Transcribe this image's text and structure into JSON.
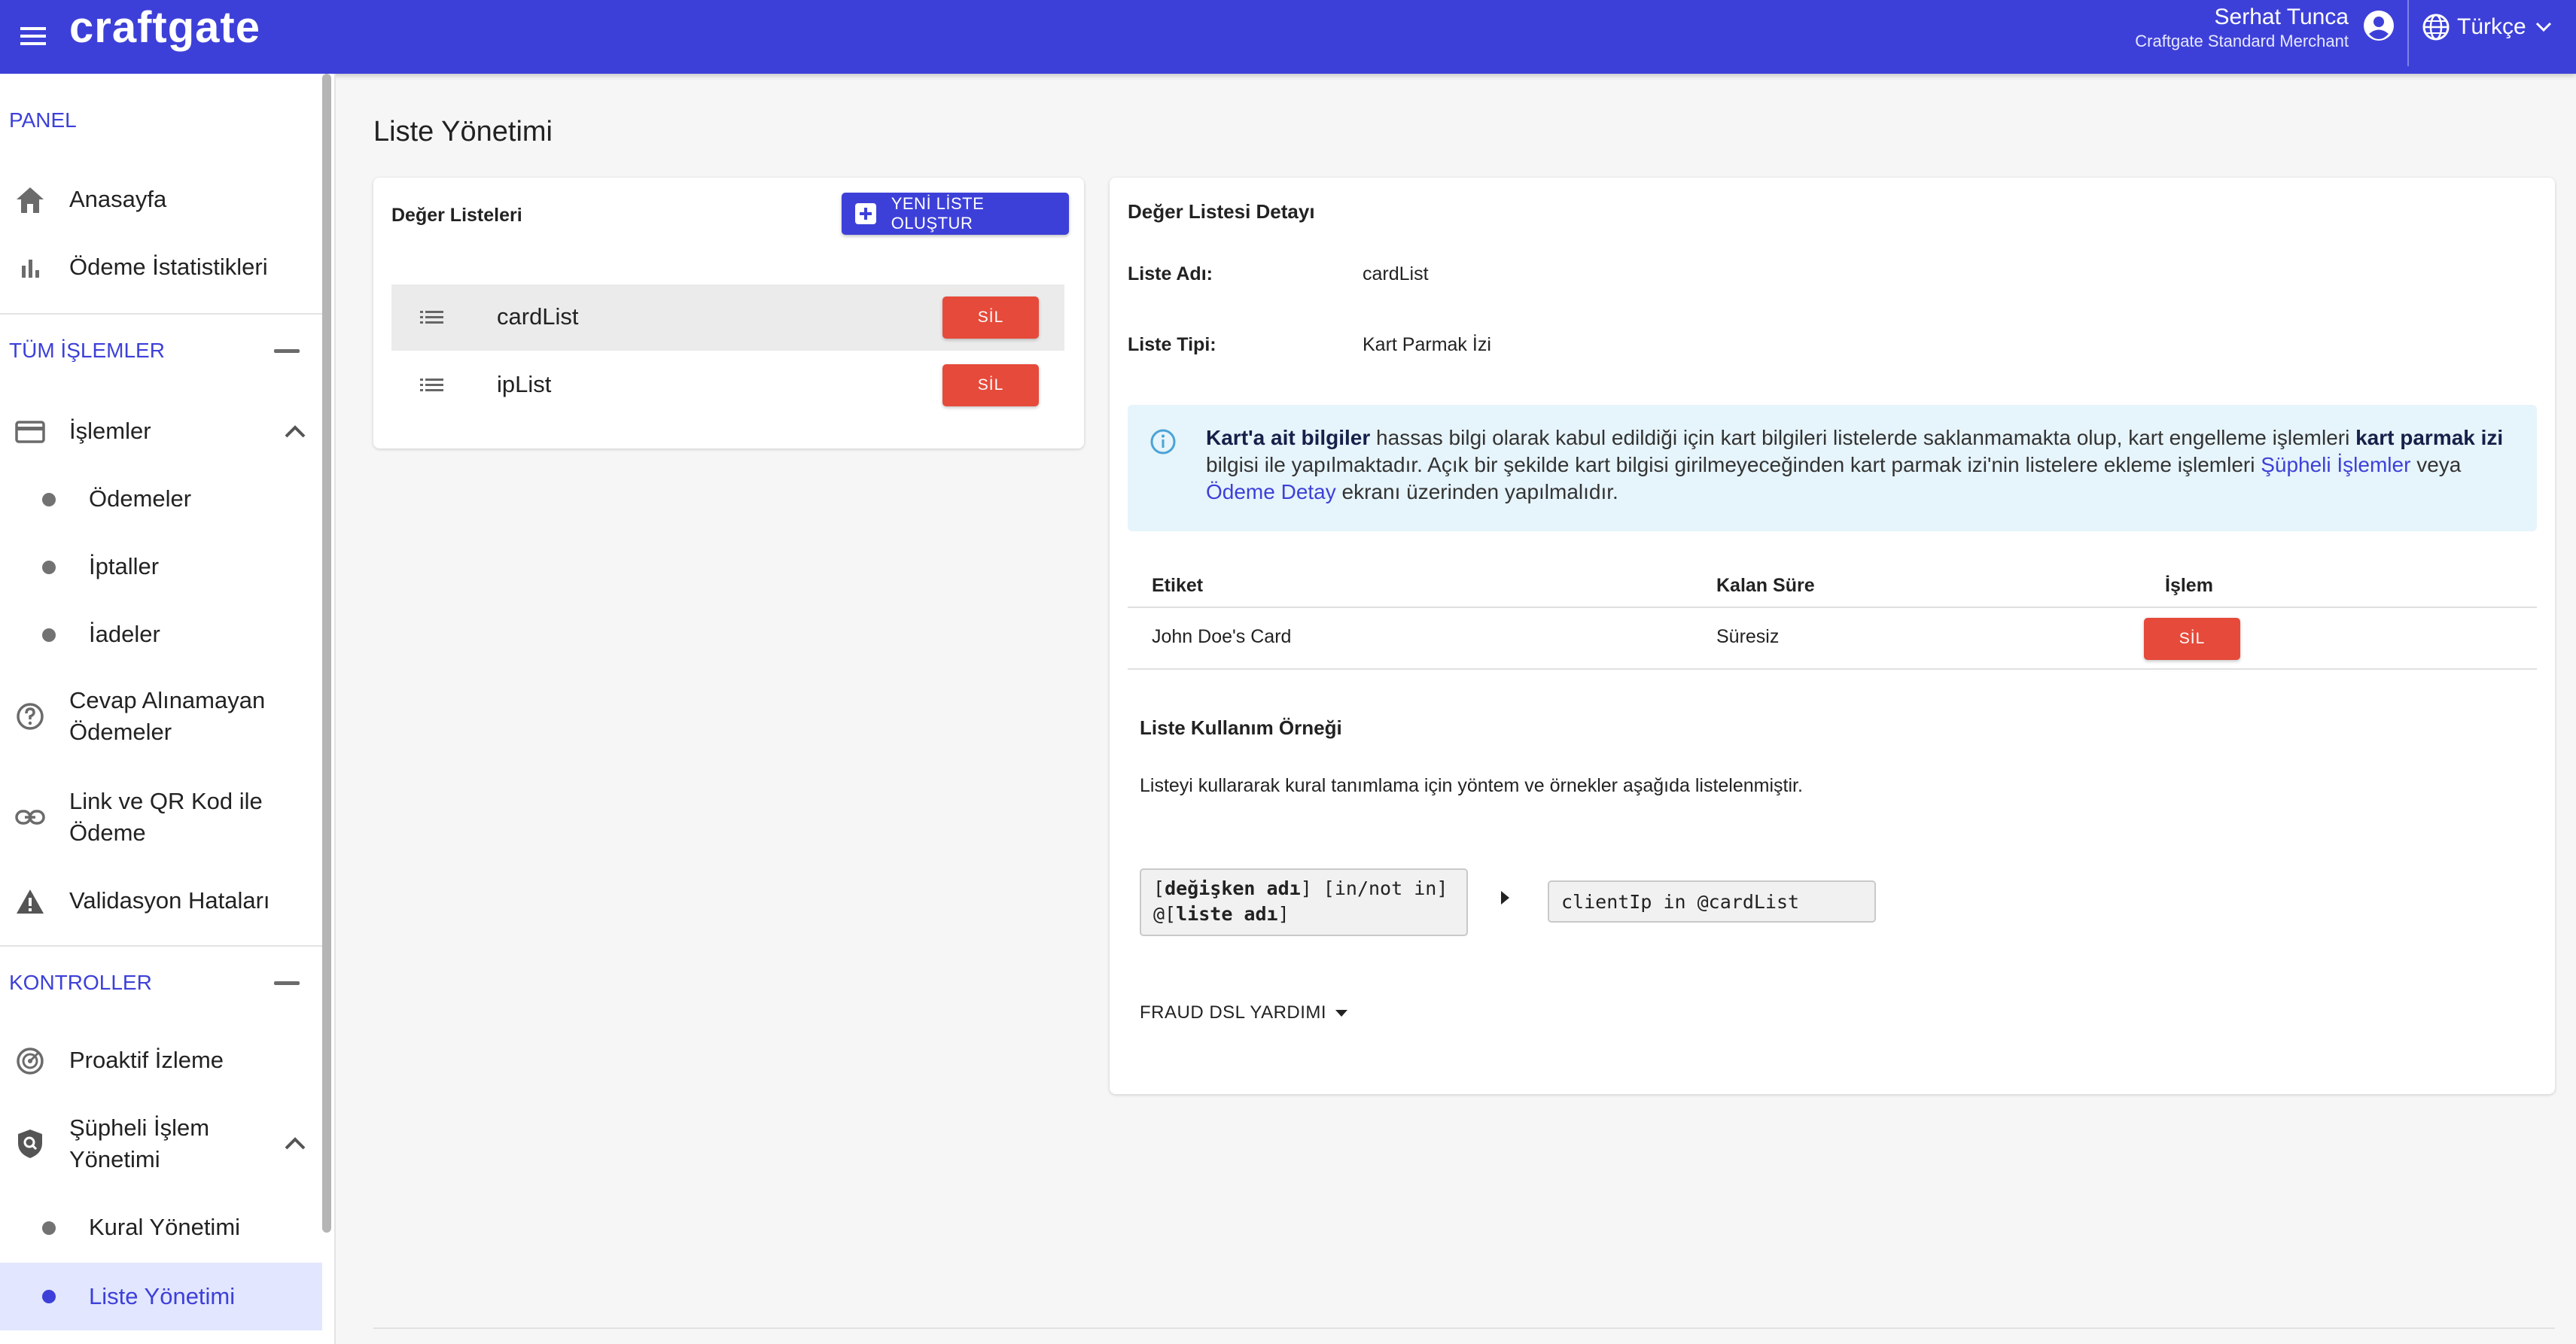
{
  "header": {
    "logo": "craftgate",
    "user_name": "Serhat Tunca",
    "user_role": "Craftgate Standard Merchant",
    "language": "Türkçe",
    "colors": {
      "primary": "#3d40d8"
    },
    "icons": [
      "menu-icon",
      "account-circle-icon",
      "globe-icon",
      "chevron-down-icon"
    ]
  },
  "sidebar": {
    "sections": [
      {
        "title": "PANEL"
      },
      {
        "title": "TÜM İŞLEMLER"
      },
      {
        "title": "KONTROLLER"
      }
    ],
    "items": {
      "anasayfa": "Anasayfa",
      "odeme_istatistikleri": "Ödeme İstatistikleri",
      "islemler": "İşlemler",
      "odemeler": "Ödemeler",
      "iptaller": "İptaller",
      "iadeler": "İadeler",
      "cevap_line1": "Cevap Alınamayan",
      "cevap_line2": "Ödemeler",
      "link_line1": "Link ve QR Kod ile",
      "link_line2": "Ödeme",
      "validasyon": "Validasyon Hataları",
      "proaktif": "Proaktif İzleme",
      "supheli_line1": "Şüpheli İşlem",
      "supheli_line2": "Yönetimi",
      "kural": "Kural Yönetimi",
      "liste": "Liste Yönetimi"
    },
    "active_item": "Liste Yönetimi"
  },
  "page": {
    "title": "Liste Yönetimi"
  },
  "lists_panel": {
    "title": "Değer Listeleri",
    "new_button": "YENİ LİSTE OLUŞTUR",
    "lists": [
      {
        "name": "cardList",
        "delete_label": "SİL",
        "selected": true
      },
      {
        "name": "ipList",
        "delete_label": "SİL",
        "selected": false
      }
    ]
  },
  "detail": {
    "title": "Değer Listesi Detayı",
    "name_label": "Liste Adı:",
    "name_value": "cardList",
    "type_label": "Liste Tipi:",
    "type_value": "Kart Parmak İzi",
    "info": {
      "bold1": "Kart'a ait bilgiler",
      "text1": " hassas bilgi olarak kabul edildiği için kart bilgileri listelerde saklanmamakta olup, kart engelleme işlemleri ",
      "bold2": "kart parmak izi",
      "text2": " bilgisi ile yapılmaktadır. Açık bir şekilde kart bilgisi girilmeyeceğinden kart parmak izi'nin listelere ekleme işlemleri ",
      "link1": "Şüpheli İşlemler",
      "text3": " veya ",
      "link2": "Ödeme Detay",
      "text4": " ekranı üzerinden yapılmalıdır."
    },
    "table": {
      "headers": [
        "Etiket",
        "Kalan Süre",
        "İşlem"
      ],
      "rows": [
        {
          "label": "John Doe's Card",
          "remaining": "Süresiz",
          "action": "SİL"
        }
      ]
    },
    "usage": {
      "title": "Liste Kullanım Örneği",
      "description": "Listeyi kullararak kural tanımlama için yöntem ve örnekler aşağıda listelenmiştir.",
      "syntax_var": "değişken adı",
      "syntax_op": " [in/not in]",
      "syntax_list": "liste adı",
      "example": "clientIp in @cardList"
    },
    "help_label": "FRAUD DSL YARDIMI"
  }
}
